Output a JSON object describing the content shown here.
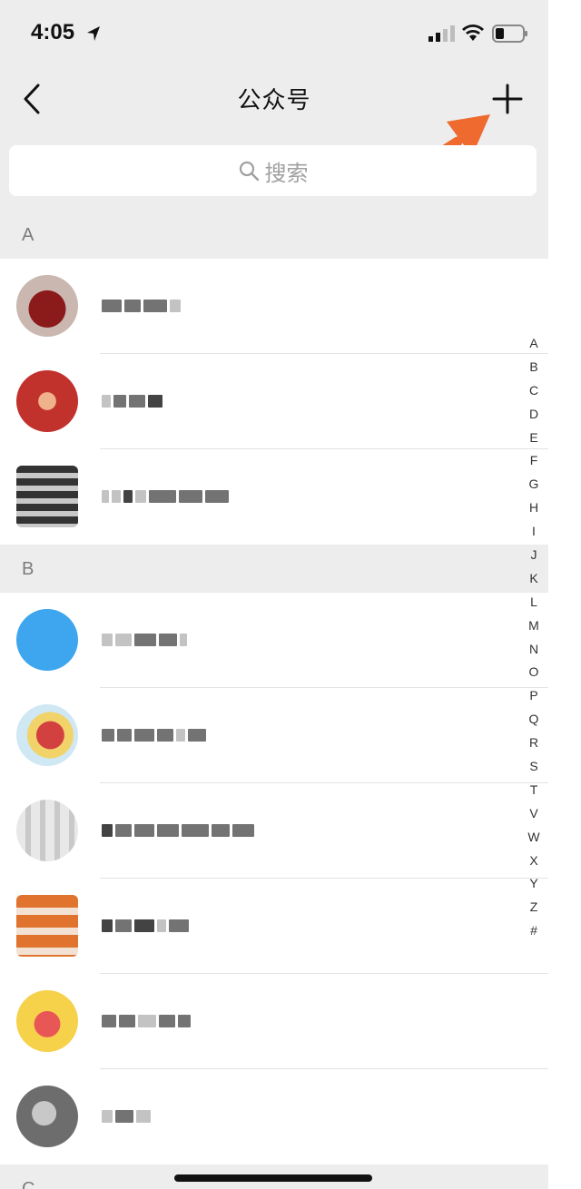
{
  "status_bar": {
    "time": "4:05"
  },
  "nav": {
    "title": "公众号"
  },
  "search": {
    "placeholder": "搜索"
  },
  "sections": [
    {
      "letter": "A",
      "rows": 3
    },
    {
      "letter": "B",
      "rows": 6
    },
    {
      "letter": "C",
      "rows": 0
    }
  ],
  "index": [
    "A",
    "B",
    "C",
    "D",
    "E",
    "F",
    "G",
    "H",
    "I",
    "J",
    "K",
    "L",
    "M",
    "N",
    "O",
    "P",
    "Q",
    "R",
    "S",
    "T",
    "V",
    "W",
    "X",
    "Y",
    "Z",
    "#"
  ],
  "colors": {
    "accent_arrow": "#ee6a2f",
    "background": "#ededed"
  }
}
